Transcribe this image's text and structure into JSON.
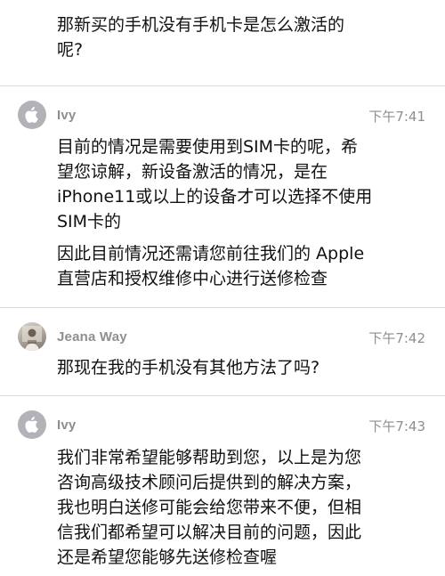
{
  "messages": [
    {
      "paragraphs": [
        "那新买的手机没有手机卡是怎么激活的\n呢?"
      ]
    },
    {
      "sender": "Ivy",
      "time": "下午7:41",
      "avatar": "apple-logo-icon",
      "paragraphs": [
        "目前的情况是需要使用到SIM卡的呢，希\n望您谅解，新设备激活的情况，是在\niPhone11或以上的设备才可以选择不使用\nSIM卡的",
        "因此目前情况还需请您前往我们的 Apple\n直营店和授权维修中心进行送修检查"
      ]
    },
    {
      "sender": "Jeana Way",
      "time": "下午7:42",
      "avatar": "user-photo",
      "paragraphs": [
        "那现在我的手机没有其他方法了吗?"
      ]
    },
    {
      "sender": "Ivy",
      "time": "下午7:43",
      "avatar": "apple-logo-icon",
      "paragraphs": [
        "我们非常希望能够帮助到您，以上是为您\n咨询高级技术顾问后提供到的解决方案，\n我也明白送修可能会给您带来不便，但相\n信我们都希望可以解决目前的问题，因此\n还是希望您能够先送修检查喔"
      ]
    }
  ]
}
